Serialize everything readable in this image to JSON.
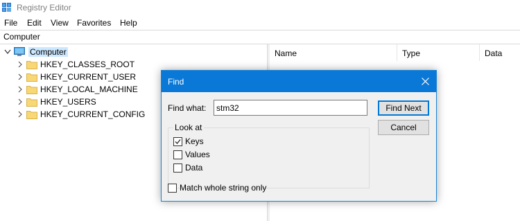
{
  "window": {
    "title": "Registry Editor"
  },
  "menu": {
    "items": [
      "File",
      "Edit",
      "View",
      "Favorites",
      "Help"
    ]
  },
  "address": {
    "path": "Computer"
  },
  "tree": {
    "root": {
      "label": "Computer",
      "icon": "computer-icon"
    },
    "items": [
      {
        "label": "HKEY_CLASSES_ROOT",
        "icon": "folder-icon"
      },
      {
        "label": "HKEY_CURRENT_USER",
        "icon": "folder-icon"
      },
      {
        "label": "HKEY_LOCAL_MACHINE",
        "icon": "folder-icon"
      },
      {
        "label": "HKEY_USERS",
        "icon": "folder-icon"
      },
      {
        "label": "HKEY_CURRENT_CONFIG",
        "icon": "folder-icon"
      }
    ]
  },
  "list": {
    "columns": [
      "Name",
      "Type",
      "Data"
    ]
  },
  "dialog": {
    "title": "Find",
    "find_what_label": "Find what:",
    "find_what_value": "stm32",
    "find_next_label": "Find Next",
    "cancel_label": "Cancel",
    "look_at_label": "Look at",
    "options": [
      {
        "label": "Keys",
        "checked": true
      },
      {
        "label": "Values",
        "checked": false
      },
      {
        "label": "Data",
        "checked": false
      }
    ],
    "match_whole": {
      "label": "Match whole string only",
      "checked": false
    }
  },
  "colors": {
    "dialog_title_bar": "#0a78d7",
    "selection": "#cce8ff",
    "folder": "#f8d775"
  }
}
